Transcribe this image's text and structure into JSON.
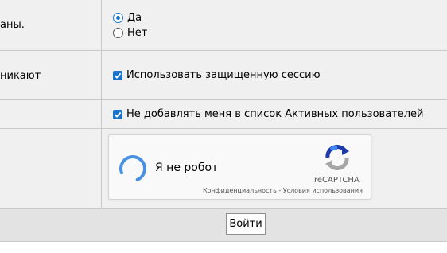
{
  "rows": {
    "row1_left": "аны.",
    "radio_yes": "Да",
    "radio_no": "Нет",
    "row2_left": "никают",
    "secure_session_label": "Использовать защищенную сессию",
    "hide_active_label": "Не добавлять меня в список Активных пользователей"
  },
  "recaptcha": {
    "label": "Я не робот",
    "brand": "reCAPTCHA",
    "privacy": "Конфиденциальность",
    "separator": " - ",
    "terms": "Условия использования"
  },
  "footer": {
    "login_button": "Войти"
  },
  "colors": {
    "accent": "#1a73c9",
    "row_bg": "#f0f0f0",
    "footer_bg": "#e3e3e3",
    "border": "#c9c9c9"
  },
  "state": {
    "radio_selected": "Да",
    "secure_session_checked": true,
    "hide_active_checked": true
  }
}
